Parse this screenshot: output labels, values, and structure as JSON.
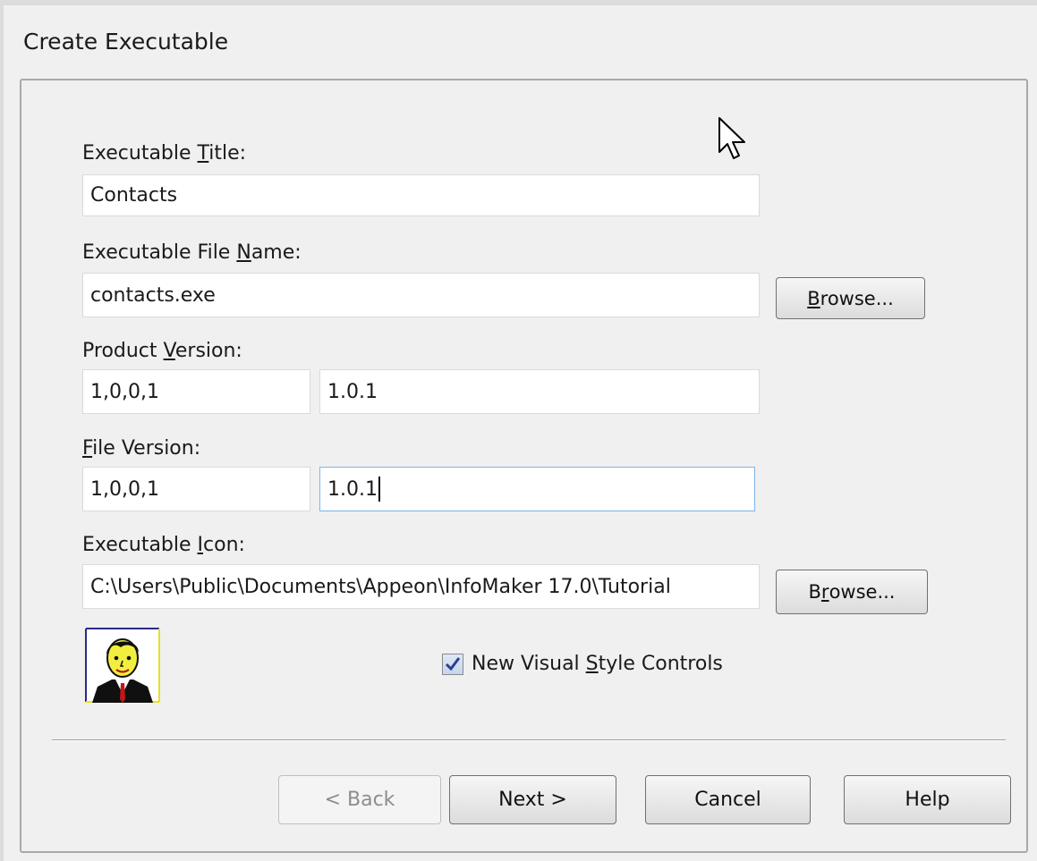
{
  "window": {
    "title": "Create Executable"
  },
  "executable_title": {
    "label_pre": "Executable ",
    "label_key": "T",
    "label_post": "itle:",
    "value": "Contacts"
  },
  "file_name": {
    "label_pre": "Executable File ",
    "label_key": "N",
    "label_post": "ame:",
    "value": "contacts.exe",
    "browse_pre": "",
    "browse_key": "B",
    "browse_post": "rowse..."
  },
  "product_version": {
    "label_pre": "Product ",
    "label_key": "V",
    "label_post": "ersion:",
    "numeric": "1,0,0,1",
    "string": "1.0.1"
  },
  "file_version": {
    "label_pre": "",
    "label_key": "F",
    "label_post": "ile Version:",
    "numeric": "1,0,0,1",
    "string": "1.0.1"
  },
  "icon": {
    "label_pre": "Executable ",
    "label_key": "I",
    "label_post": "con:",
    "path": "C:\\Users\\Public\\Documents\\Appeon\\InfoMaker 17.0\\Tutorial",
    "browse_pre": "B",
    "browse_key": "r",
    "browse_post": "owse..."
  },
  "visual_style": {
    "label_pre": "New Visual ",
    "label_key": "S",
    "label_post": "tyle Controls",
    "checked": true
  },
  "buttons": {
    "back": "< Back",
    "next": "Next >",
    "cancel": "Cancel",
    "help": "Help"
  }
}
